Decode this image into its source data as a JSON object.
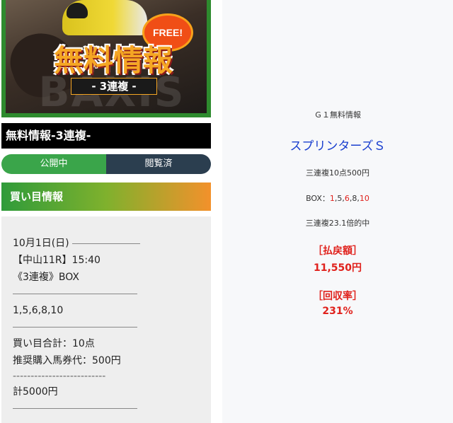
{
  "banner": {
    "free_badge": "FREE!",
    "title": "無料情報",
    "subtitle": "- 3連複 -",
    "watermark": "BAXIS"
  },
  "heading": "無料情報-3連複-",
  "tabs": [
    {
      "label": "公開中",
      "active": true
    },
    {
      "label": "閲覧済",
      "active": false
    }
  ],
  "section_title": "買い目情報",
  "info": {
    "date": "10月1日(日)",
    "race": "【中山11R】15:40",
    "bet_type": "《3連複》BOX",
    "numbers": "1,5,6,8,10",
    "total_points": "買い目合計：10点",
    "recommended": "推奨購入馬券代：500円",
    "dashes": "--------------------------",
    "sum": "計5000円"
  },
  "result": {
    "title": "Ｇ１無料情報",
    "race_name": "スプリンターズＳ",
    "bet_summary": "三連複10点500円",
    "box_prefix": "BOX：",
    "box_numbers": [
      {
        "n": "1",
        "hit": true,
        "sep": ","
      },
      {
        "n": "5",
        "hit": false,
        "sep": ","
      },
      {
        "n": "6",
        "hit": true,
        "sep": ","
      },
      {
        "n": "8",
        "hit": false,
        "sep": ","
      },
      {
        "n": "10",
        "hit": true,
        "sep": ""
      }
    ],
    "hit_text": "三連複23.1倍的中",
    "payout_label": "［払戻額］",
    "payout_value": "11,550円",
    "return_label": "［回収率］",
    "return_value": "231%"
  },
  "colors": {
    "tab_active": "#3aa54a",
    "tab_inactive": "#2b3e4f",
    "race_blue": "#1a3fcf",
    "hit_red": "#e0211c"
  }
}
